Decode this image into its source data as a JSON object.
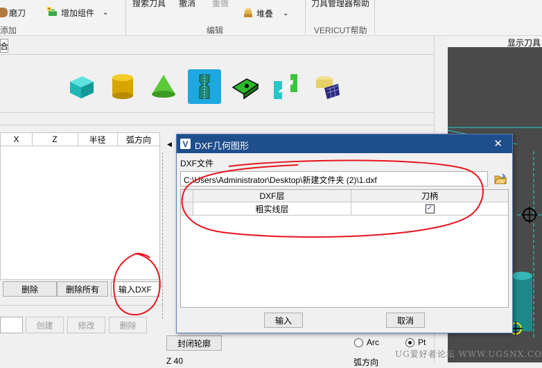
{
  "ribbon": {
    "grind_label": "磨刀",
    "add_component_label": "增加组件",
    "search_tool_label": "搜索刀具",
    "undo_label": "撤消",
    "redo_label": "重做",
    "stack_label": "堆叠",
    "tool_manager_help_label": "刀具管理器帮助",
    "group_add_partial": "添加",
    "group_edit_label": "编辑",
    "group_help_label": "VERICUT帮助"
  },
  "left_panel": {
    "combine_tab_partial": "合",
    "profile_columns": [
      "X",
      "Z",
      "半径",
      "弧方向"
    ],
    "delete_label": "删除",
    "delete_all_label": "删除所有",
    "import_dxf_label": "输入DXF",
    "create_label": "创建",
    "modify_label": "修改",
    "remove_label": "删除",
    "close_profile_label": "封闭轮廓",
    "arc_label": "Arc",
    "pt_label": "Pt",
    "z_value_partial": "Z  40",
    "arc_dir_partial": "弧方向"
  },
  "viewport": {
    "show_tool_label": "显示刀具"
  },
  "dialog": {
    "title": "DXF几何图形",
    "file_label": "DXF文件",
    "file_path": "C:\\Users\\Administrator\\Desktop\\新建文件夹 (2)\\1.dxf",
    "col_layer": "DXF层",
    "col_holder": "刀柄",
    "row_layer": "粗实线层",
    "row_checked": true,
    "ok_label": "输入",
    "cancel_label": "取消"
  },
  "watermark": "UG爱好者论坛 WWW.UGSNX.COM",
  "colors": {
    "title_bar": "#1f4e8c",
    "ink": "#e8141c",
    "viewport_bg": "#4a4a4a",
    "selected_icon": "#1ea8e0"
  }
}
